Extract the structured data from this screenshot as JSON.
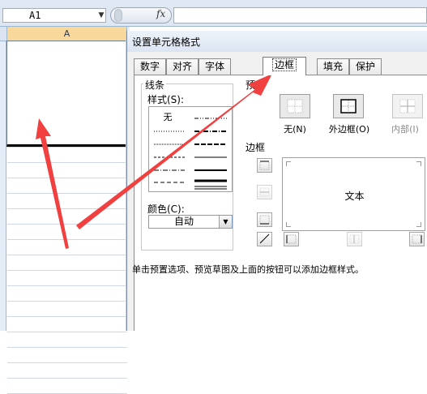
{
  "formula_bar": {
    "name_box": "A1",
    "fx_label": "fx"
  },
  "sheet": {
    "column_header": "A"
  },
  "dialog": {
    "title": "设置单元格格式",
    "tabs": [
      {
        "label": "数字"
      },
      {
        "label": "对齐"
      },
      {
        "label": "字体"
      },
      {
        "label": "边框",
        "active": true
      },
      {
        "label": "填充"
      },
      {
        "label": "保护"
      }
    ],
    "line_group": {
      "title": "线条",
      "style_label": "样式(S):",
      "none_label": "无",
      "color_label": "颜色(C):",
      "color_value": "自动"
    },
    "presets": {
      "title": "预",
      "items": [
        {
          "label": "无(N)"
        },
        {
          "label": "外边框(O)"
        },
        {
          "label": "内部(I)",
          "disabled": true
        }
      ]
    },
    "border_group": {
      "title": "边框",
      "preview_text": "文本"
    },
    "hint": "单击预置选项、预览草图及上面的按钮可以添加边框样式。"
  },
  "colors": {
    "arrow": "#f04040",
    "tab_active_border": "#7a7a7a",
    "column_selected": "#f9d89c"
  }
}
